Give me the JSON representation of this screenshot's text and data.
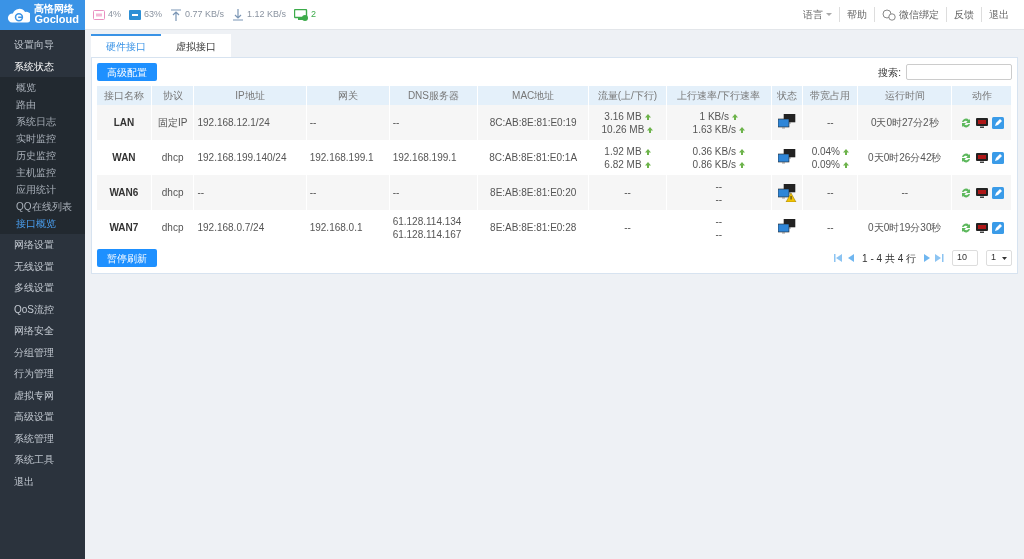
{
  "brand": {
    "name": "高恪网络",
    "sub": "Gocloud"
  },
  "stats": [
    {
      "kind": "cpu",
      "text": "4%"
    },
    {
      "kind": "mem",
      "text": "63%"
    },
    {
      "kind": "up",
      "text": "0.77 KB/s"
    },
    {
      "kind": "down",
      "text": "1.12 KB/s"
    },
    {
      "kind": "users",
      "text": "2"
    }
  ],
  "top_links": [
    {
      "kind": "dropdown",
      "label": "语言"
    },
    {
      "kind": "plain",
      "label": "帮助"
    },
    {
      "kind": "wechat",
      "label": "微信绑定"
    },
    {
      "kind": "plain",
      "label": "反馈"
    },
    {
      "kind": "plain",
      "label": "退出"
    }
  ],
  "sidebar": {
    "items": [
      {
        "label": "设置向导"
      },
      {
        "label": "系统状态",
        "expanded": true,
        "children": [
          {
            "label": "概览",
            "selected": false
          },
          {
            "label": "路由",
            "selected": false
          },
          {
            "label": "系统日志",
            "selected": false
          },
          {
            "label": "实时监控",
            "selected": false
          },
          {
            "label": "历史监控",
            "selected": false
          },
          {
            "label": "主机监控",
            "selected": false
          },
          {
            "label": "应用统计",
            "selected": false
          },
          {
            "label": "QQ在线列表",
            "selected": false
          },
          {
            "label": "接口概览",
            "selected": true
          }
        ]
      },
      {
        "label": "网络设置"
      },
      {
        "label": "无线设置"
      },
      {
        "label": "多线设置"
      },
      {
        "label": "QoS流控"
      },
      {
        "label": "网络安全"
      },
      {
        "label": "分组管理"
      },
      {
        "label": "行为管理"
      },
      {
        "label": "虚拟专网"
      },
      {
        "label": "高级设置"
      },
      {
        "label": "系统管理"
      },
      {
        "label": "系统工具"
      },
      {
        "label": "退出"
      }
    ]
  },
  "tabs": [
    {
      "label": "硬件接口",
      "selected": true
    },
    {
      "label": "虚拟接口",
      "selected": false
    }
  ],
  "advanced_button": "高级配置",
  "search": {
    "label": "搜索:"
  },
  "table": {
    "columns": [
      "接口名称",
      "协议",
      "IP地址",
      "网关",
      "DNS服务器",
      "MAC地址",
      "流量(上/下行)",
      "上行速率/下行速率",
      "状态",
      "带宽占用",
      "运行时间",
      "动作"
    ],
    "rows": [
      {
        "name": "LAN",
        "protocol": "固定IP",
        "ip": "192.168.12.1/24",
        "gateway": "--",
        "dns": [
          "--"
        ],
        "mac": "8C:AB:8E:81:E0:19",
        "traffic": [
          {
            "text": "3.16 MB",
            "arrow": true
          },
          {
            "text": "10.26 MB",
            "arrow": true
          }
        ],
        "rate": [
          {
            "text": "1 KB/s",
            "arrow": true
          },
          {
            "text": "1.63 KB/s",
            "arrow": true
          }
        ],
        "warning": false,
        "bandwidth": [
          {
            "text": "--",
            "arrow": false
          }
        ],
        "uptime": "0天0时27分2秒"
      },
      {
        "name": "WAN",
        "protocol": "dhcp",
        "ip": "192.168.199.140/24",
        "gateway": "192.168.199.1",
        "dns": [
          "192.168.199.1"
        ],
        "mac": "8C:AB:8E:81:E0:1A",
        "traffic": [
          {
            "text": "1.92 MB",
            "arrow": true
          },
          {
            "text": "6.82 MB",
            "arrow": true
          }
        ],
        "rate": [
          {
            "text": "0.36 KB/s",
            "arrow": true
          },
          {
            "text": "0.86 KB/s",
            "arrow": true
          }
        ],
        "warning": false,
        "bandwidth": [
          {
            "text": "0.04%",
            "arrow": true
          },
          {
            "text": "0.09%",
            "arrow": true
          }
        ],
        "uptime": "0天0时26分42秒"
      },
      {
        "name": "WAN6",
        "protocol": "dhcp",
        "ip": "--",
        "gateway": "--",
        "dns": [
          "--"
        ],
        "mac": "8E:AB:8E:81:E0:20",
        "traffic": [
          {
            "text": "--",
            "arrow": false
          }
        ],
        "rate": [
          {
            "text": "--",
            "arrow": false
          },
          {
            "text": "--",
            "arrow": false
          }
        ],
        "warning": true,
        "bandwidth": [
          {
            "text": "--",
            "arrow": false
          }
        ],
        "uptime": "--"
      },
      {
        "name": "WAN7",
        "protocol": "dhcp",
        "ip": "192.168.0.7/24",
        "gateway": "192.168.0.1",
        "dns": [
          "61.128.114.134",
          "61.128.114.167"
        ],
        "mac": "8E:AB:8E:81:E0:28",
        "traffic": [
          {
            "text": "--",
            "arrow": false
          }
        ],
        "rate": [
          {
            "text": "--",
            "arrow": false
          },
          {
            "text": "--",
            "arrow": false
          }
        ],
        "warning": false,
        "bandwidth": [
          {
            "text": "--",
            "arrow": false
          }
        ],
        "uptime": "0天0时19分30秒"
      }
    ]
  },
  "pause_button": "暂停刷新",
  "pager": {
    "info": "1 - 4 共 4 行",
    "page_size": "10",
    "page": "1"
  }
}
